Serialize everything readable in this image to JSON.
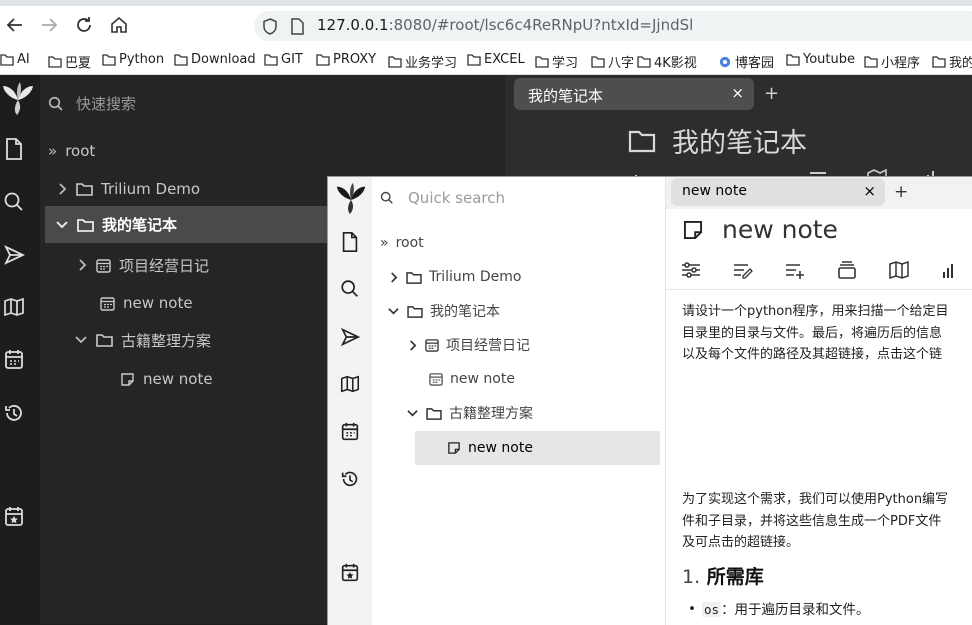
{
  "browser": {
    "url_host": "127.0.0.1",
    "url_rest": ":8080/#root/lsc6c4ReRNpU?ntxId=JjndSl",
    "bookmarks": [
      "AI",
      "巴夏",
      "Python",
      "Download",
      "GIT",
      "PROXY",
      "业务学习",
      "EXCEL",
      "学习",
      "八字",
      "4K影视",
      "博客园",
      "Youtube",
      "小程序",
      "我的"
    ]
  },
  "main": {
    "search_placeholder": "快速搜索",
    "tree": {
      "root": "root",
      "n1": "Trilium Demo",
      "n2": "我的笔记本",
      "n3": "项目经营日记",
      "n4": "new note",
      "n5": "古籍整理方案",
      "n6": "new note"
    },
    "tab_title": "我的笔记本",
    "tab_close": "×",
    "tab_add": "+",
    "note_title": "我的笔记本"
  },
  "popup": {
    "search_placeholder": "Quick search",
    "tree": {
      "root": "root",
      "n1": "Trilium Demo",
      "n2": "我的笔记本",
      "n3": "项目经营日记",
      "n4": "new note",
      "n5": "古籍整理方案",
      "n6": "new note"
    },
    "tab_title": "new note",
    "tab_close": "×",
    "tab_add": "+",
    "note_title": "new note",
    "content": {
      "p1_l1": "请设计一个python程序，用来扫描一个给定目",
      "p1_l2": "目录里的目录与文件。最后，将遍历后的信息",
      "p1_l3": "以及每个文件的路径及其超链接，点击这个链",
      "p2_l1": "为了实现这个需求，我们可以使用Python编写",
      "p2_l2": "件和子目录，并将这些信息生成一个PDF文件",
      "p2_l3": "及可点击的超链接。",
      "h_num": "1.",
      "h_text": "所需库",
      "b1_code": "os",
      "b1_text": "：用于遍历目录和文件。"
    }
  }
}
